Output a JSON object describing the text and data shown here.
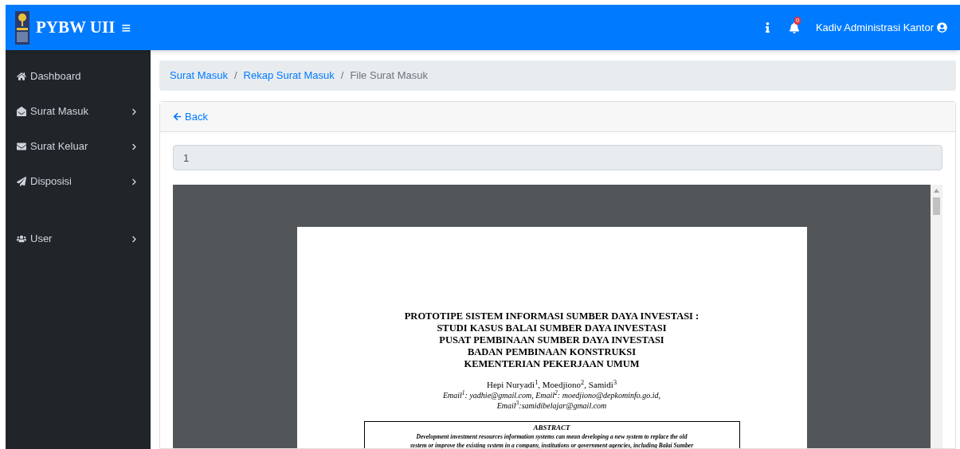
{
  "navbar": {
    "brand": "PYBW UII",
    "menu_icon": "≡",
    "notifications": {
      "count": "0"
    },
    "user": "Kadiv Administrasi Kantor"
  },
  "sidebar": {
    "items": [
      {
        "label": "Dashboard",
        "kind": "home",
        "has_children": false
      },
      {
        "label": "Surat Masuk",
        "kind": "inbox",
        "has_children": true
      },
      {
        "label": "Surat Keluar",
        "kind": "mail",
        "has_children": true
      },
      {
        "label": "Disposisi",
        "kind": "send",
        "has_children": true
      },
      {
        "label": "User",
        "kind": "users",
        "has_children": true
      }
    ]
  },
  "breadcrumb": [
    {
      "label": "Surat Masuk",
      "link": true
    },
    {
      "separator": "/",
      "label": "Rekap Surat Masuk",
      "link": true
    },
    {
      "separator": "/",
      "label": "File Surat Masuk",
      "link": false
    }
  ],
  "card": {
    "back": "Back",
    "field_value": "1",
    "document": {
      "title_lines": [
        "PROTOTIPE SISTEM INFORMASI SUMBER DAYA INVESTASI :",
        "STUDI KASUS BALAI SUMBER DAYA INVESTASI",
        "PUSAT PEMBINAAN SUMBER DAYA INVESTASI",
        "BADAN PEMBINAAN KONSTRUKSI",
        "KEMENTERIAN PEKERJAAN UMUM"
      ],
      "authors": "Hepi Nuryadi$^{1}$, Moedjiono$^{2}$, Samidi$^{3}$",
      "emails": [
        "Email$^{1}$: yadhie@gmail.com, Email$^{2}$: moedjiono@depkominfo.go.id,",
        "Email$^{3}$:samidibelajar@gmail.com"
      ],
      "abstract_heading": "ABSTRACT",
      "abstract_lines": [
        "Development investment resources information systems can mean developing a new system to replace the old",
        "system or improve the existing system in a company, institutions or government agencies, including Balai Sumber"
      ]
    }
  }
}
